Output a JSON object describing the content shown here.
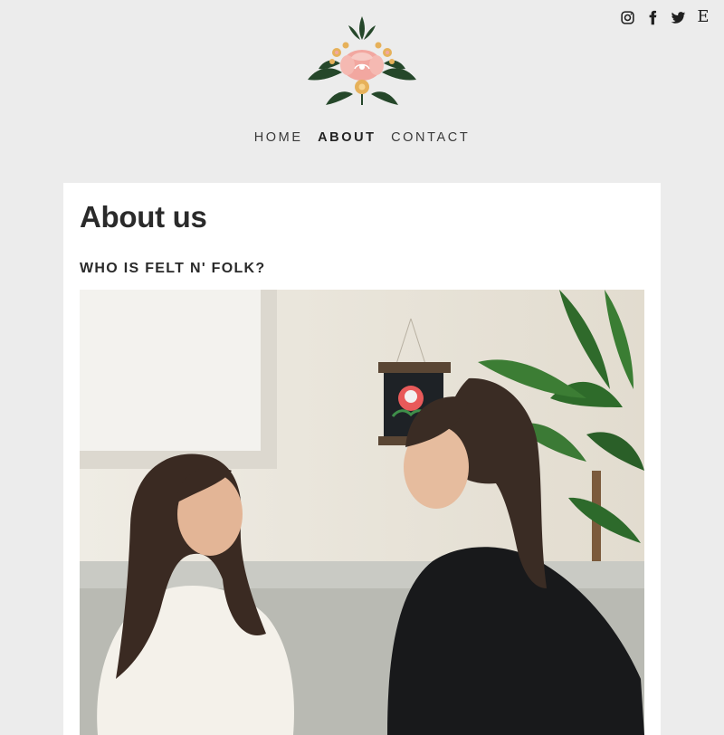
{
  "social": {
    "icons": [
      "instagram-icon",
      "facebook-icon",
      "twitter-icon",
      "etsy-icon"
    ],
    "etsy_letter": "E"
  },
  "nav": {
    "items": [
      {
        "label": "HOME",
        "active": false
      },
      {
        "label": "ABOUT",
        "active": true
      },
      {
        "label": "CONTACT",
        "active": false
      }
    ]
  },
  "main": {
    "title": "About us",
    "subtitle": "WHO IS FELT N' FOLK?"
  },
  "colors": {
    "background": "#ececec",
    "card": "#ffffff",
    "text": "#2a2a2a",
    "logo_pink": "#f2a7a0",
    "logo_green": "#25472a",
    "logo_gold": "#e6b15a"
  }
}
